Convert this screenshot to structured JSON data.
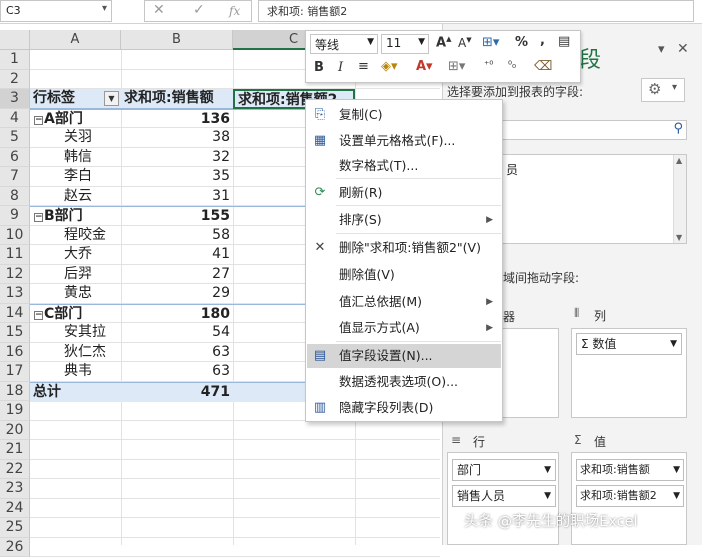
{
  "formula_bar": {
    "name_box": "C3",
    "content": "求和项: 销售额2"
  },
  "columns": [
    "A",
    "B",
    "C"
  ],
  "rows": [
    "1",
    "2",
    "3",
    "4",
    "5",
    "6",
    "7",
    "8",
    "9",
    "10",
    "11",
    "12",
    "13",
    "14",
    "15",
    "16",
    "17",
    "18",
    "19",
    "20",
    "21",
    "22",
    "23",
    "24",
    "25",
    "26"
  ],
  "pivot": {
    "header": {
      "row_label": "行标签",
      "value1": "求和项:销售额",
      "value2": "求和项:销售额2"
    },
    "lines": [
      {
        "label": "A部门",
        "value": "136",
        "group": true
      },
      {
        "label": "关羽",
        "value": "38",
        "group": false
      },
      {
        "label": "韩信",
        "value": "32",
        "group": false
      },
      {
        "label": "李白",
        "value": "35",
        "group": false
      },
      {
        "label": "赵云",
        "value": "31",
        "group": false
      },
      {
        "label": "B部门",
        "value": "155",
        "group": true
      },
      {
        "label": "程咬金",
        "value": "58",
        "group": false
      },
      {
        "label": "大乔",
        "value": "41",
        "group": false
      },
      {
        "label": "后羿",
        "value": "27",
        "group": false
      },
      {
        "label": "黄忠",
        "value": "29",
        "group": false
      },
      {
        "label": "C部门",
        "value": "180",
        "group": true
      },
      {
        "label": "安其拉",
        "value": "54",
        "group": false
      },
      {
        "label": "狄仁杰",
        "value": "63",
        "group": false
      },
      {
        "label": "典韦",
        "value": "63",
        "group": false
      }
    ],
    "total": {
      "label": "总计",
      "value": "471"
    }
  },
  "mini_toolbar": {
    "font_name": "等线",
    "font_size": "11"
  },
  "context_menu": [
    {
      "label": "复制(C)",
      "icon": "copy-icon",
      "submenu": false
    },
    {
      "label": "设置单元格格式(F)...",
      "icon": "format-cells-icon",
      "submenu": false
    },
    {
      "label": "数字格式(T)...",
      "icon": "",
      "submenu": false
    },
    {
      "label": "刷新(R)",
      "icon": "refresh-icon",
      "submenu": false
    },
    {
      "label": "排序(S)",
      "icon": "",
      "submenu": true
    },
    {
      "label": "删除\"求和项:销售额2\"(V)",
      "icon": "delete-x-icon",
      "submenu": false
    },
    {
      "label": "删除值(V)",
      "icon": "",
      "submenu": false
    },
    {
      "label": "值汇总依据(M)",
      "icon": "",
      "submenu": true
    },
    {
      "label": "值显示方式(A)",
      "icon": "",
      "submenu": true
    },
    {
      "label": "值字段设置(N)...",
      "icon": "value-field-settings-icon",
      "submenu": false,
      "highlighted": true
    },
    {
      "label": "数据透视表选项(O)...",
      "icon": "",
      "submenu": false
    },
    {
      "label": "隐藏字段列表(D)",
      "icon": "hide-field-list-icon",
      "submenu": false
    }
  ],
  "field_pane": {
    "title_partial": "段",
    "choose_fields_label": "选择要添加到报表的字段:",
    "field_item_partial": "员",
    "drag_label_partial": "域间拖动字段:",
    "filter_area_partial": "器",
    "columns_area": {
      "label": "列",
      "items": [
        "数值"
      ]
    },
    "rows_area": {
      "label": "行",
      "items": [
        "部门",
        "销售人员"
      ]
    },
    "values_area": {
      "label": "值",
      "items": [
        "求和项:销售额",
        "求和项:销售额2"
      ]
    }
  },
  "watermark": "头条 @李先生的职场Excel"
}
